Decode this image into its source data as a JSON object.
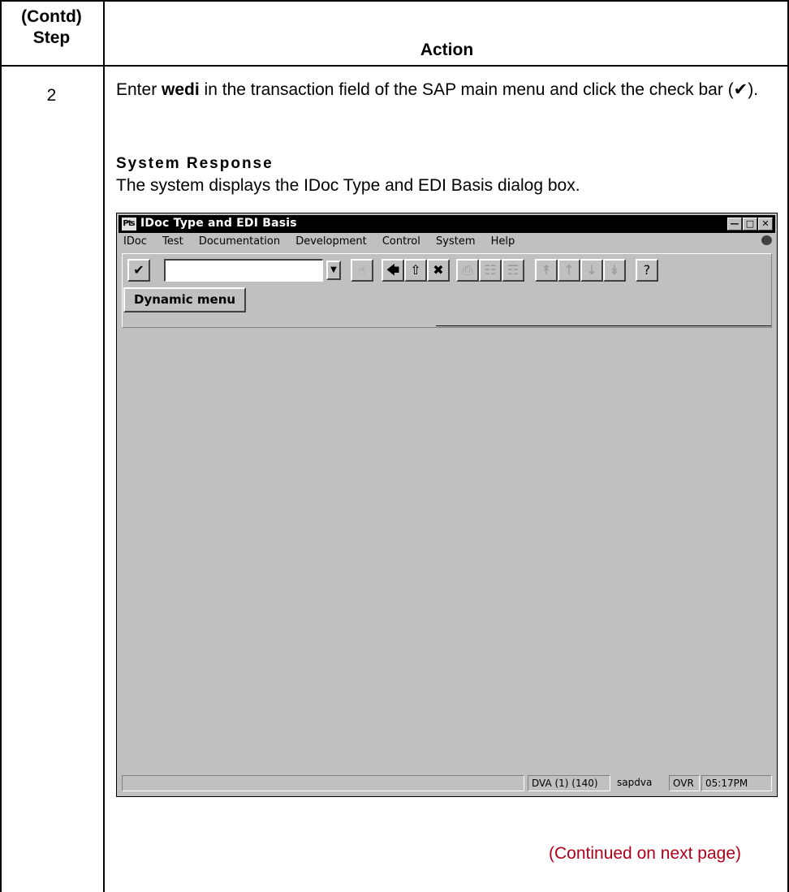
{
  "table": {
    "header_step": "(Contd)\nStep",
    "header_step_line1": "(Contd)",
    "header_step_line2": "Step",
    "header_action": "Action"
  },
  "step": {
    "number": "2",
    "instruction_pre": "Enter ",
    "instruction_bold": "wedi",
    "instruction_post": " in the transaction field of the SAP main menu and click the check bar (✔).",
    "response_heading": "System Response",
    "response_text": "The system displays the IDoc Type and EDI Basis dialog box."
  },
  "footer": {
    "continued": "(Continued on next page)"
  },
  "sap_window": {
    "title": "IDoc Type and EDI Basis",
    "app_icon": "sap-app-icon",
    "window_buttons": [
      "minimize",
      "maximize",
      "close"
    ],
    "menu": [
      "IDoc",
      "Test",
      "Documentation",
      "Development",
      "Control",
      "System",
      "Help"
    ],
    "toolbar": {
      "command_field_value": "",
      "dynamic_menu_label": "Dynamic menu"
    },
    "status": {
      "message": "",
      "system": "DVA (1) (140)",
      "server": "sapdva",
      "mode": "OVR",
      "time": "05:17PM"
    }
  },
  "colors": {
    "window_bg": "#c0c0c0",
    "titlebar_bg": "#000000",
    "continued_text": "#b0001a"
  }
}
